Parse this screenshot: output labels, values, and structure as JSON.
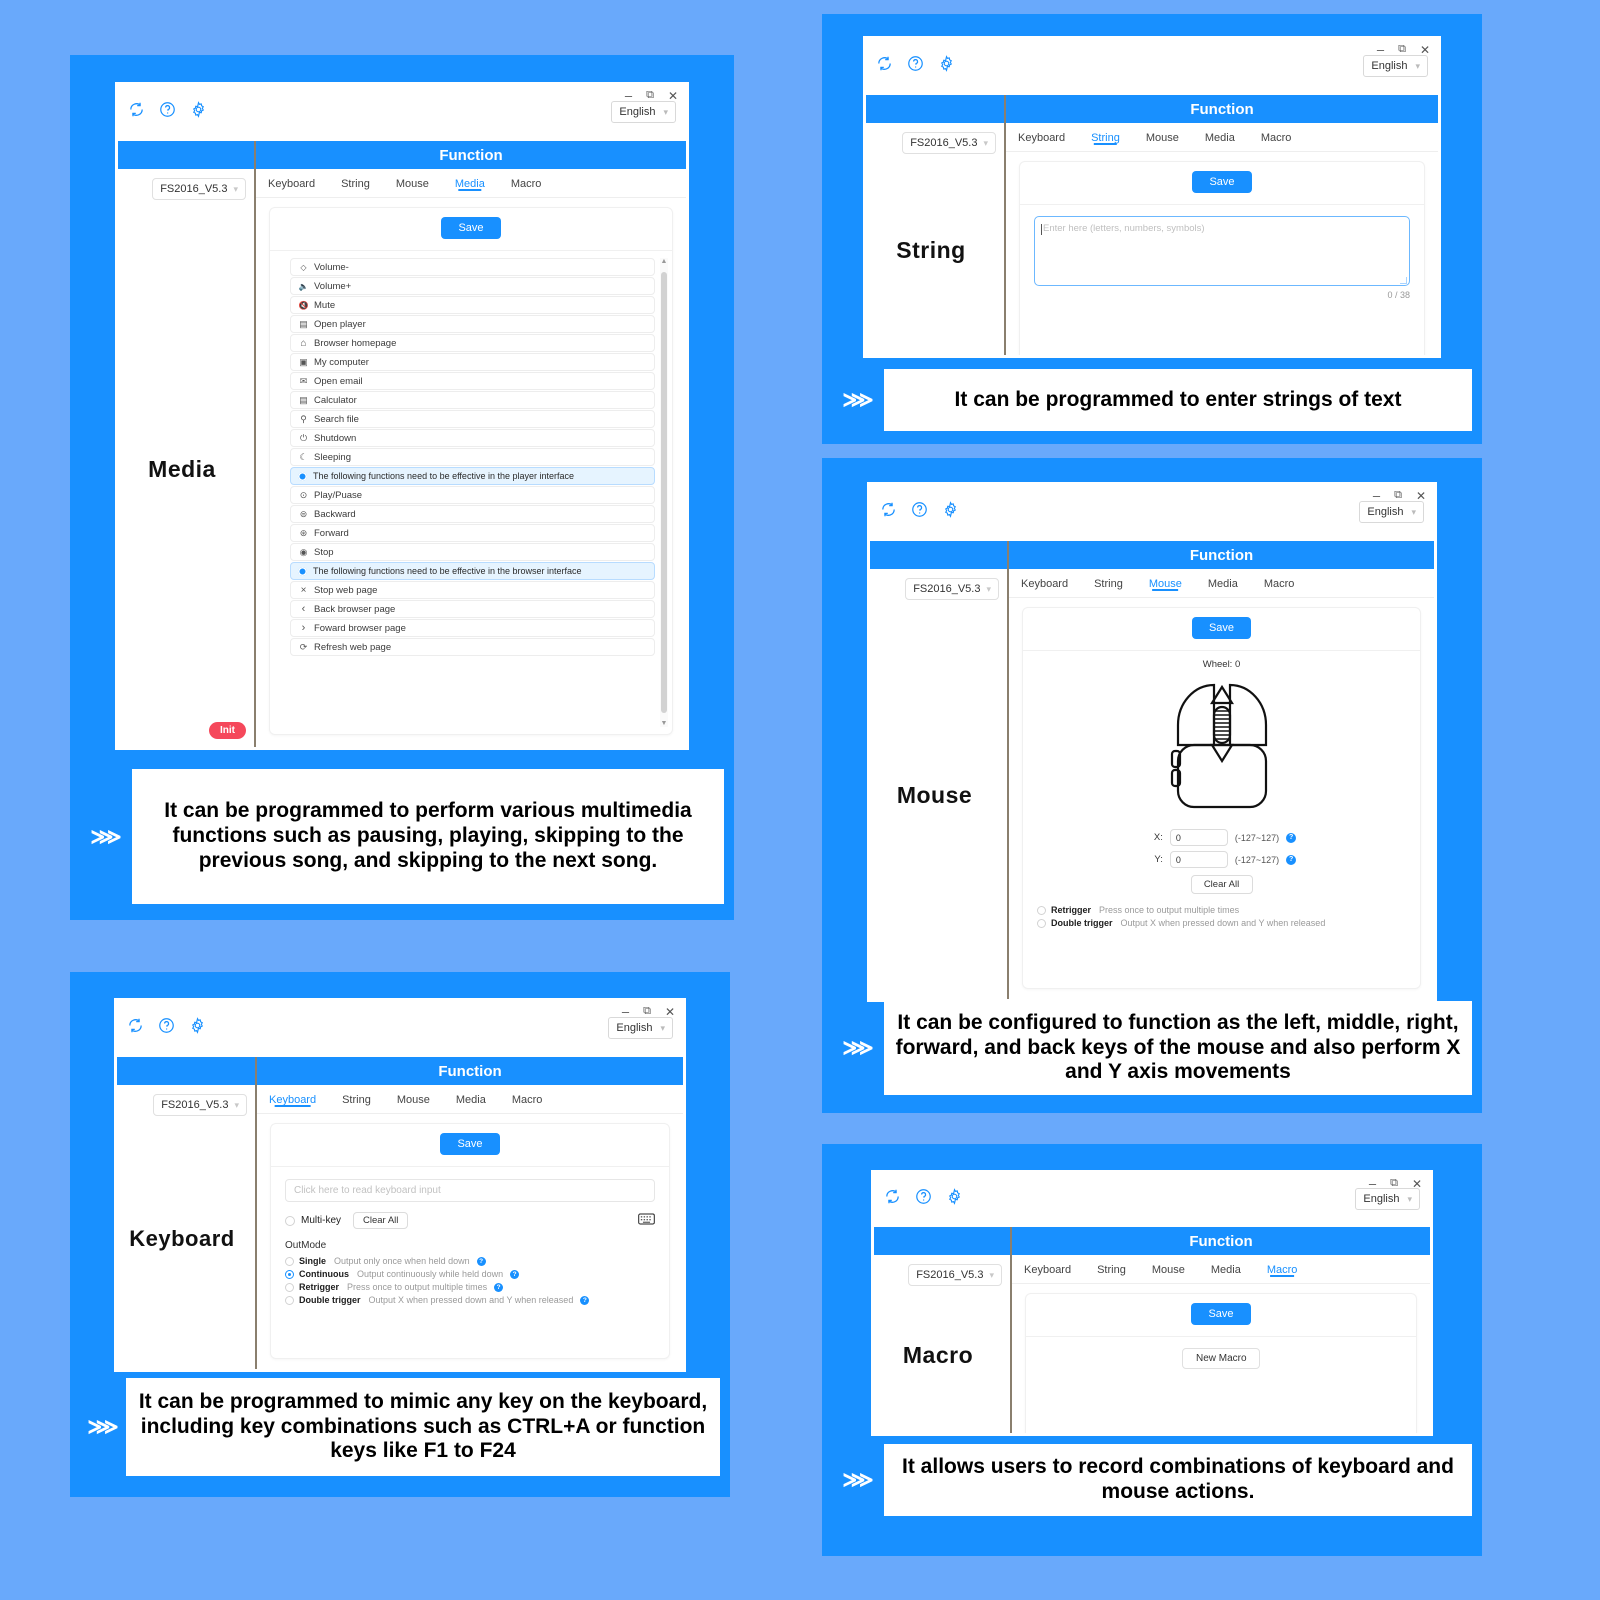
{
  "app": {
    "window_controls": {
      "minimize": "–",
      "maximize": "⧉",
      "close": "✕"
    },
    "language": "English",
    "device": "FS2016_V5.3",
    "function_title": "Function",
    "tabs": [
      "Keyboard",
      "String",
      "Mouse",
      "Media",
      "Macro"
    ],
    "save_label": "Save"
  },
  "panels": {
    "media": {
      "label": "Media",
      "active_tab": "Media",
      "init_label": "Init",
      "items": [
        {
          "icon": "·○·",
          "glyph": "ᴗ",
          "label": "Volume-"
        },
        {
          "icon": "speaker-down-icon",
          "glyph": "⧏‖",
          "label": "Volume+"
        },
        {
          "icon": "speaker-mute-icon",
          "glyph": "⧏×",
          "label": "Mute"
        },
        {
          "icon": "player-icon",
          "glyph": "⊞",
          "label": "Open player"
        },
        {
          "icon": "home-icon",
          "glyph": "⌂",
          "label": "Browser homepage"
        },
        {
          "icon": "computer-icon",
          "glyph": "▣",
          "label": "My computer"
        },
        {
          "icon": "mail-icon",
          "glyph": "✉",
          "label": "Open email"
        },
        {
          "icon": "calculator-icon",
          "glyph": "▤",
          "label": "Calculator"
        },
        {
          "icon": "search-icon",
          "glyph": "⚲",
          "label": "Search file"
        },
        {
          "icon": "power-icon",
          "glyph": "⏻",
          "label": "Shutdown"
        },
        {
          "icon": "moon-icon",
          "glyph": "☾",
          "label": "Sleeping"
        },
        {
          "icon": "info-icon",
          "glyph": "",
          "label": "The following functions need to be effective in the player interface",
          "note": true
        },
        {
          "icon": "play-pause-icon",
          "glyph": "⊙",
          "label": "Play/Puase"
        },
        {
          "icon": "backward-icon",
          "glyph": "⊜",
          "label": "Backward"
        },
        {
          "icon": "forward-icon",
          "glyph": "⊛",
          "label": "Forward"
        },
        {
          "icon": "stop-icon",
          "glyph": "◉",
          "label": "Stop"
        },
        {
          "icon": "info-icon",
          "glyph": "",
          "label": "The following functions need to be effective in the browser interface",
          "note": true
        },
        {
          "icon": "close-icon",
          "glyph": "×",
          "label": "Stop web page"
        },
        {
          "icon": "chevron-left-icon",
          "glyph": "‹",
          "label": "Back browser page"
        },
        {
          "icon": "chevron-right-icon",
          "glyph": "›",
          "label": "Foward browser page"
        },
        {
          "icon": "refresh-icon",
          "glyph": "⟳",
          "label": "Refresh web page"
        }
      ],
      "caption": "It can be programmed to perform various multimedia functions such as pausing, playing, skipping to the previous song, and skipping to the next song."
    },
    "string": {
      "label": "String",
      "active_tab": "String",
      "placeholder": "Enter here (letters, numbers, symbols)",
      "value": "",
      "counter": "0 / 38",
      "caption": "It can be programmed to enter strings of text"
    },
    "mouse": {
      "label": "Mouse",
      "active_tab": "Mouse",
      "wheel_label": "Wheel: 0",
      "x_label": "X:",
      "x_value": "0",
      "y_label": "Y:",
      "y_value": "0",
      "range_hint": "(-127~127)",
      "help_glyph": "?",
      "clear_all": "Clear All",
      "options": [
        {
          "name": "Retrigger",
          "desc": "Press once to output multiple times",
          "checked": false
        },
        {
          "name": "Double trigger",
          "desc": "Output X when pressed down and Y when released",
          "checked": false
        }
      ],
      "caption": "It can be configured to function as the left, middle, right, forward, and back keys of the mouse and also perform X and Y axis movements"
    },
    "keyboard": {
      "label": "Keyboard",
      "active_tab": "Keyboard",
      "input_placeholder": "Click here to read keyboard input",
      "multikey_label": "Multi-key",
      "multikey_checked": false,
      "clear_all": "Clear All",
      "outmode_label": "OutMode",
      "outmode_options": [
        {
          "name": "Single",
          "desc": "Output only once when held down",
          "checked": false
        },
        {
          "name": "Continuous",
          "desc": "Output continuously while held down",
          "checked": true
        },
        {
          "name": "Retrigger",
          "desc": "Press once to output multiple times",
          "checked": false
        },
        {
          "name": "Double trigger",
          "desc": "Output X when pressed down and Y when released",
          "checked": false
        }
      ],
      "help_glyph": "?",
      "caption": "It can be programmed to mimic any key on the keyboard, including key combinations such as CTRL+A or function keys like F1 to F24"
    },
    "macro": {
      "label": "Macro",
      "active_tab": "Macro",
      "new_macro": "New Macro",
      "caption": "It allows users to record combinations of keyboard and mouse actions."
    }
  },
  "colors": {
    "page_bg": "#69a9fb",
    "card_bg": "#1890ff",
    "accent": "#1890ff",
    "init_red": "#f5485b",
    "note_bg": "#e6f4ff"
  }
}
